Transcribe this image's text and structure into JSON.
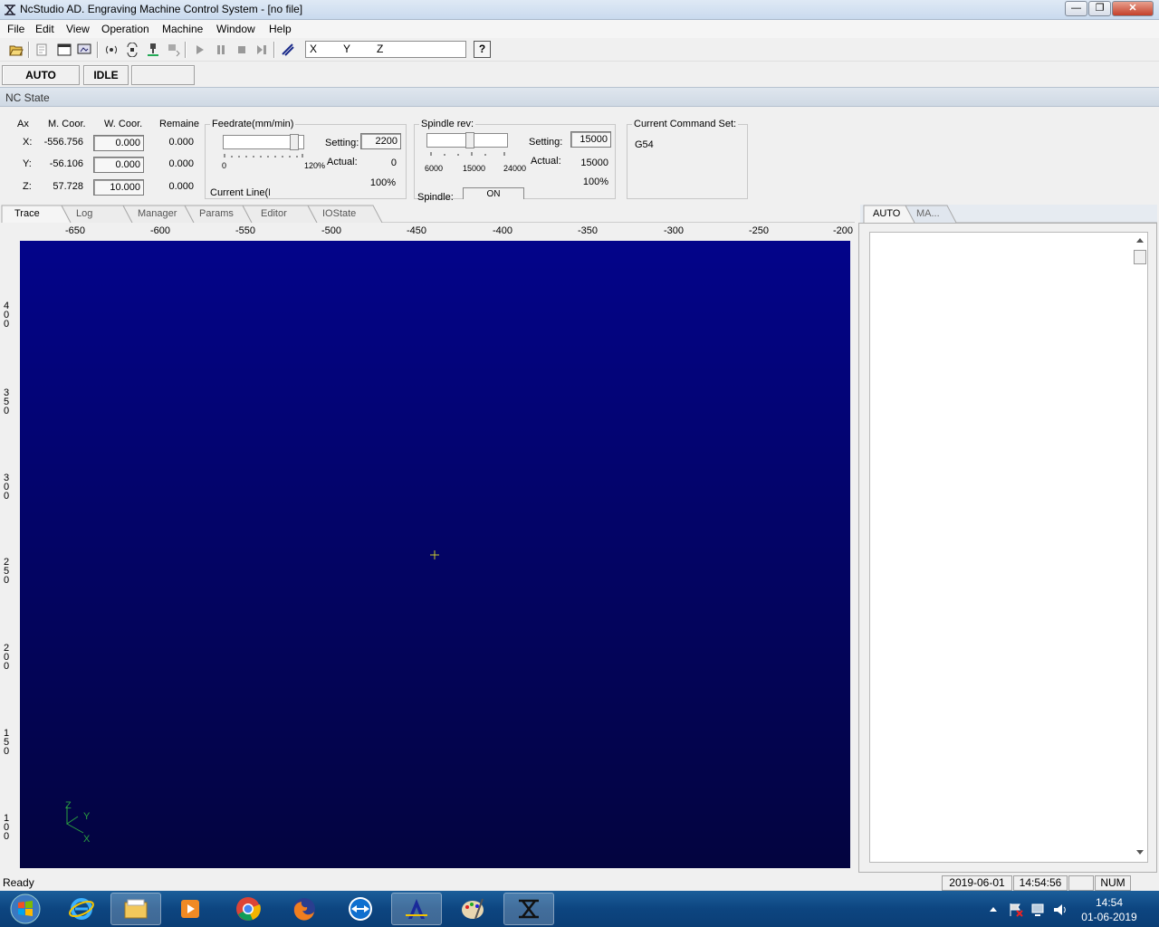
{
  "window": {
    "title": "NcStudio AD. Engraving Machine Control System  - [no file]",
    "min_label": "—",
    "max_label": "❐",
    "close_label": "✕"
  },
  "menu": [
    "File",
    "Edit",
    "View",
    "Operation",
    "Machine",
    "Window",
    "Help"
  ],
  "toolbar": {
    "axes": [
      "X",
      "Y",
      "Z"
    ],
    "help_label": "?"
  },
  "status_row": {
    "mode": "AUTO",
    "state": "IDLE",
    "extra": ""
  },
  "nc_state": {
    "header": "NC State",
    "headers": {
      "axis": "Ax",
      "mcoor": "M. Coor.",
      "wcoor": "W. Coor.",
      "remain": "Remaine"
    },
    "rows": [
      {
        "axis": "X:",
        "mcoor": "-556.756",
        "wcoor": "0.000",
        "remain": "0.000"
      },
      {
        "axis": "Y:",
        "mcoor": "-56.106",
        "wcoor": "0.000",
        "remain": "0.000"
      },
      {
        "axis": "Z:",
        "mcoor": "57.728",
        "wcoor": "10.000",
        "remain": "0.000"
      }
    ],
    "feedrate": {
      "title": "Feedrate(mm/min)",
      "setting_label": "Setting:",
      "setting": "2200",
      "actual_label": "Actual:",
      "actual": "0",
      "percent": "100%",
      "scale_min": "0",
      "scale_max": "120%",
      "current_line": "Current Line(E"
    },
    "spindle": {
      "title": "Spindle rev:",
      "setting_label": "Setting:",
      "setting": "15000",
      "actual_label": "Actual:",
      "actual": "15000",
      "percent": "100%",
      "scale": [
        "6000",
        "15000",
        "24000"
      ],
      "spindle_label": "Spindle:",
      "spindle_state": "ON"
    },
    "command_set": {
      "title": "Current Command Set:",
      "value": "G54"
    }
  },
  "tabs": [
    "Trace",
    "Log",
    "Manager",
    "Params",
    "Editor",
    "IOState"
  ],
  "right_tabs": [
    "AUTO",
    "MA..."
  ],
  "ruler": {
    "x_ticks": [
      "-650",
      "-600",
      "-550",
      "-500",
      "-450",
      "-400",
      "-350",
      "-300",
      "-250",
      "-200"
    ],
    "y_ticks": [
      "400",
      "350",
      "300",
      "250",
      "200",
      "150",
      "100"
    ]
  },
  "canvas": {
    "axis_labels": {
      "z": "Z",
      "y": "Y",
      "x": "X"
    },
    "colors": {
      "top": "#03048a",
      "bottom": "#03043f",
      "crosshair": "#c8c830"
    }
  },
  "statusbar": {
    "text": "Ready",
    "date": "2019-06-01",
    "time": "14:54:56",
    "blank": "",
    "num": "NUM"
  },
  "tray": {
    "time": "14:54",
    "date": "01-06-2019"
  }
}
